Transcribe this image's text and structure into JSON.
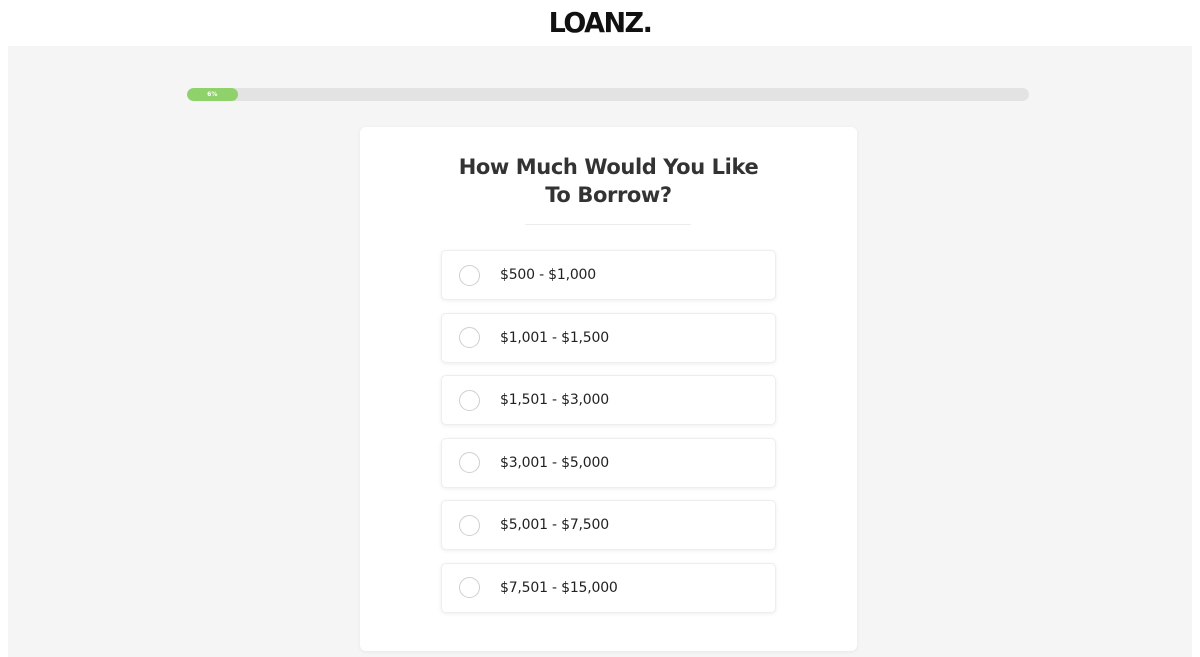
{
  "header": {
    "logo_text": "LOANZ."
  },
  "progress": {
    "percent": 6,
    "label": "6%",
    "fill_color": "#8fd16a",
    "track_color": "#e3e3e3"
  },
  "form": {
    "question": "How Much Would You Like To Borrow?",
    "options": [
      {
        "label": "$500 - $1,000",
        "selected": false
      },
      {
        "label": "$1,001 - $1,500",
        "selected": false
      },
      {
        "label": "$1,501 - $3,000",
        "selected": false
      },
      {
        "label": "$3,001 - $5,000",
        "selected": false
      },
      {
        "label": "$5,001 - $7,500",
        "selected": false
      },
      {
        "label": "$7,501 - $15,000",
        "selected": false
      }
    ]
  },
  "colors": {
    "background": "#f5f5f5",
    "card": "#ffffff",
    "text": "#333333"
  }
}
